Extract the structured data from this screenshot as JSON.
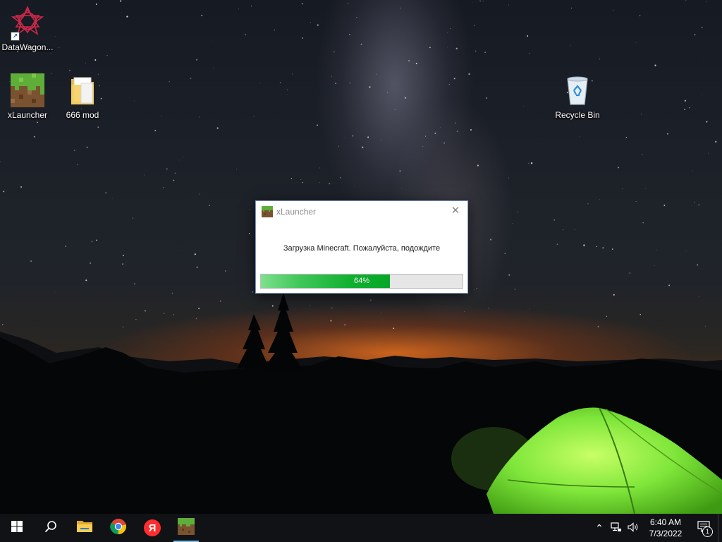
{
  "desktop": {
    "icons": [
      {
        "label": "DataWagon...",
        "icon": "datawagon-app-icon"
      },
      {
        "label": "xLauncher",
        "icon": "minecraft-grass-block-icon"
      },
      {
        "label": "666 mod",
        "icon": "folder-icon"
      },
      {
        "label": "Recycle Bin",
        "icon": "recycle-bin-icon"
      }
    ]
  },
  "dialog": {
    "title": "xLauncher",
    "close_glyph": "✕",
    "message": "Загрузка Minecraft. Пожалуйста, подождите",
    "progress": {
      "value": 0.64,
      "label": "64%"
    }
  },
  "taskbar": {
    "apps": [
      "start-icon",
      "search-icon",
      "file-explorer-icon",
      "chrome-icon",
      "yandex-browser-icon",
      "xlauncher-icon"
    ],
    "active_app": "xlauncher-icon",
    "yandex_glyph": "Я",
    "tray": {
      "chevron_glyph": "⌃",
      "time": "6:40 AM",
      "date": "7/3/2022",
      "notification_count": "1"
    }
  },
  "colors": {
    "taskbar": "#101215",
    "progress_fill": "#06a627",
    "progress_track": "#e6e6e6",
    "active_indicator": "#76b9ed",
    "tent": "#7fe63a"
  }
}
